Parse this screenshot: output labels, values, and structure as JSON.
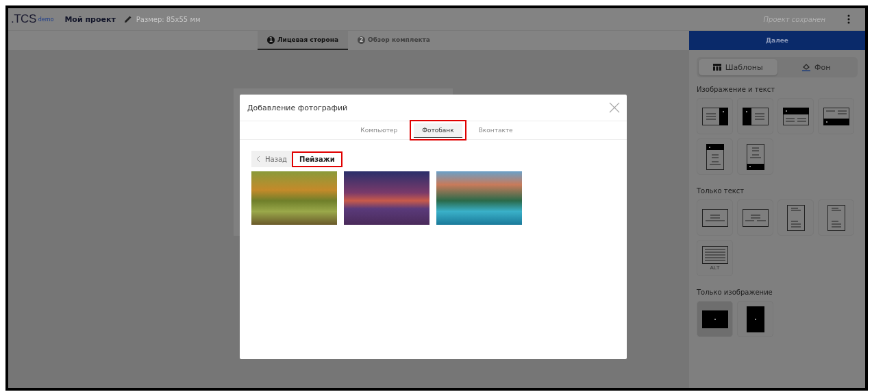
{
  "header": {
    "logo": ".TCS",
    "logo_badge": "demo",
    "project_name": "Мой проект",
    "size": "Размер: 85x55 мм",
    "status": "Проект сохранен"
  },
  "steps": [
    {
      "number": "1",
      "label": "Лицевая сторона",
      "selected": true
    },
    {
      "number": "2",
      "label": "Обзор комплекта",
      "selected": false
    }
  ],
  "next_button": "Далее",
  "panel_tabs": [
    {
      "label": "Шаблоны",
      "kind": "templates",
      "selected": true
    },
    {
      "label": "Фон",
      "kind": "background",
      "selected": false
    }
  ],
  "template_groups": [
    {
      "title": "Изображение и текст",
      "items": [
        {
          "kind": "img-right",
          "selected": false
        },
        {
          "kind": "img-left",
          "selected": false
        },
        {
          "kind": "img-top",
          "selected": false
        },
        {
          "kind": "img-bottom",
          "selected": false
        },
        {
          "kind": "portrait-img-top",
          "selected": false
        },
        {
          "kind": "portrait-img-bottom",
          "selected": false
        }
      ]
    },
    {
      "title": "Только текст",
      "items": [
        {
          "kind": "text-center",
          "selected": false
        },
        {
          "kind": "text-columns",
          "selected": false
        },
        {
          "kind": "portrait-text",
          "selected": false
        },
        {
          "kind": "portrait-text",
          "selected": false
        },
        {
          "kind": "text-full",
          "label": "ALT",
          "selected": false
        }
      ]
    },
    {
      "title": "Только изображение",
      "items": [
        {
          "kind": "img-full",
          "selected": true
        },
        {
          "kind": "portrait-img-full",
          "selected": false
        }
      ]
    }
  ],
  "dialog": {
    "title": "Добавление фотографий",
    "tabs": [
      {
        "label": "Компьютер",
        "selected": false,
        "highlighted": false
      },
      {
        "label": "Фотобанк",
        "selected": true,
        "highlighted": true
      },
      {
        "label": "Вконтакте",
        "selected": false,
        "highlighted": false
      }
    ],
    "back_button": "Назад",
    "category": "Пейзажи",
    "category_highlighted": true,
    "photos": [
      {
        "kind": "forest"
      },
      {
        "kind": "sunset"
      },
      {
        "kind": "mountains"
      }
    ]
  }
}
